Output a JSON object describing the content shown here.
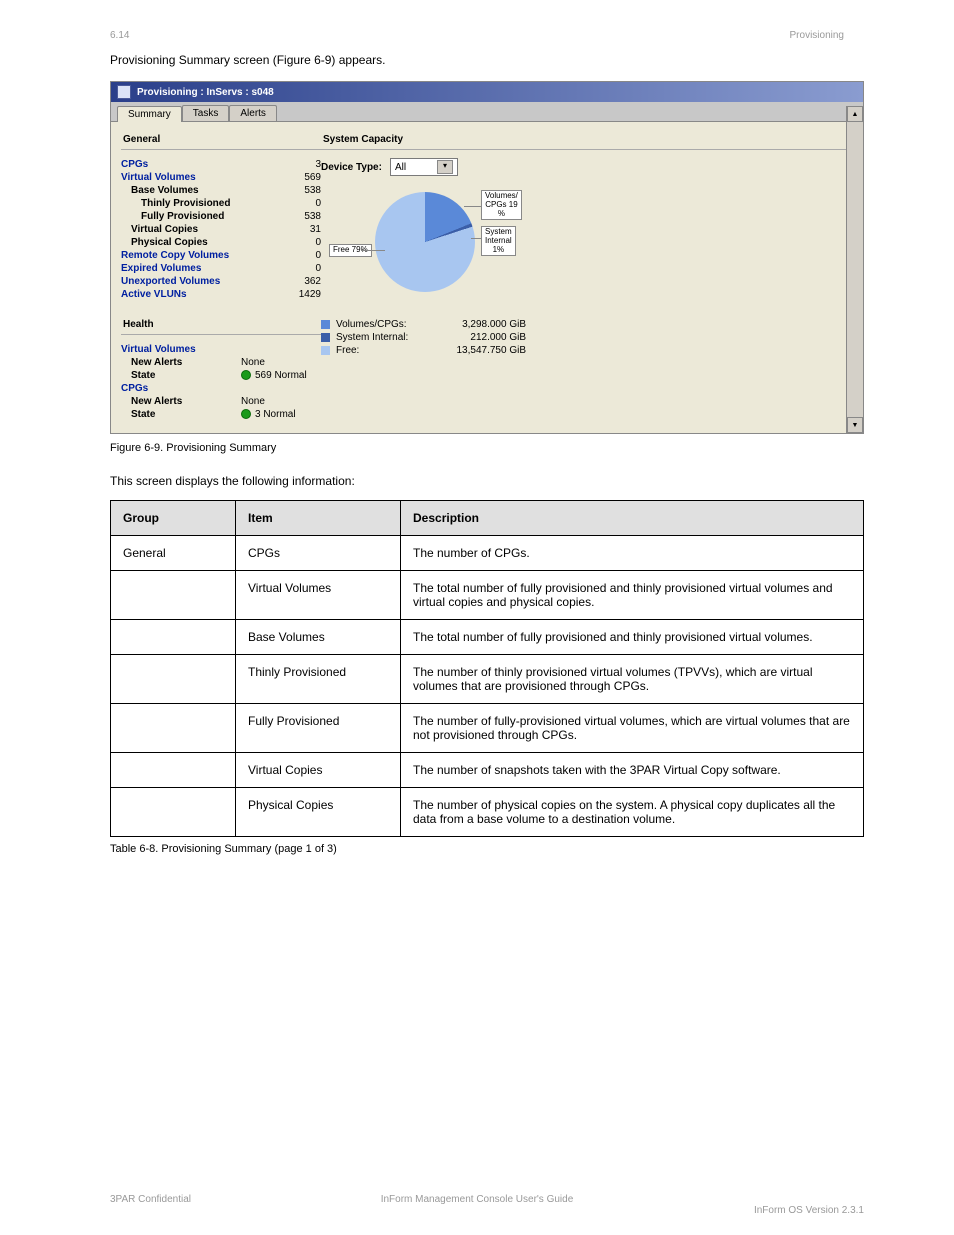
{
  "header": {
    "left": "6.14",
    "right": "Provisioning"
  },
  "intro": "Provisioning Summary screen (Figure 6-9) appears.",
  "window": {
    "title": "Provisioning : InServs : s048",
    "tabs": [
      "Summary",
      "Tasks",
      "Alerts"
    ],
    "sections": {
      "general_title": "General",
      "capacity_title": "System Capacity",
      "health_title": "Health"
    },
    "general": [
      {
        "label": "CPGs",
        "value": "3",
        "link": true,
        "indent": 0
      },
      {
        "label": "Virtual Volumes",
        "value": "569",
        "link": true,
        "indent": 0
      },
      {
        "label": "Base Volumes",
        "value": "538",
        "link": false,
        "indent": 1
      },
      {
        "label": "Thinly Provisioned",
        "value": "0",
        "link": false,
        "indent": 2
      },
      {
        "label": "Fully Provisioned",
        "value": "538",
        "link": false,
        "indent": 2
      },
      {
        "label": "Virtual Copies",
        "value": "31",
        "link": false,
        "indent": 1
      },
      {
        "label": "Physical Copies",
        "value": "0",
        "link": false,
        "indent": 1
      },
      {
        "label": "Remote Copy Volumes",
        "value": "0",
        "link": true,
        "indent": 0
      },
      {
        "label": "Expired Volumes",
        "value": "0",
        "link": true,
        "indent": 0
      },
      {
        "label": "Unexported Volumes",
        "value": "362",
        "link": true,
        "indent": 0
      },
      {
        "label": "Active VLUNs",
        "value": "1429",
        "link": true,
        "indent": 0
      }
    ],
    "device_type_label": "Device Type:",
    "device_type_value": "All",
    "callouts": {
      "free": "Free 79%",
      "vol": "Volumes/\nCPGs 19\n%",
      "sys": "System\nInternal\n1%"
    },
    "legend": [
      {
        "label": "Volumes/CPGs:",
        "value": "3,298.000 GiB",
        "sw": "blue1"
      },
      {
        "label": "System Internal:",
        "value": "212.000 GiB",
        "sw": "blue2"
      },
      {
        "label": "Free:",
        "value": "13,547.750 GiB",
        "sw": "blue3"
      }
    ],
    "health": {
      "vv": {
        "title": "Virtual Volumes",
        "alerts_label": "New Alerts",
        "alerts_value": "None",
        "state_label": "State",
        "state_value": "569 Normal"
      },
      "cpg": {
        "title": "CPGs",
        "alerts_label": "New Alerts",
        "alerts_value": "None",
        "state_label": "State",
        "state_value": "3 Normal"
      }
    }
  },
  "fig_caption": "Figure 6-9.  Provisioning Summary",
  "explain": "This screen displays the following information:",
  "chart_data": {
    "type": "pie",
    "title": "System Capacity",
    "series": [
      {
        "name": "Volumes/CPGs",
        "value": 3298.0,
        "percent": 19,
        "unit": "GiB"
      },
      {
        "name": "System Internal",
        "value": 212.0,
        "percent": 1,
        "unit": "GiB"
      },
      {
        "name": "Free",
        "value": 13547.75,
        "percent": 79,
        "unit": "GiB"
      }
    ]
  },
  "table": {
    "headers": [
      "Group",
      "Item",
      "Description"
    ],
    "rows": [
      {
        "group": "General",
        "item": "CPGs",
        "desc": "The number of CPGs."
      },
      {
        "group": "",
        "item": "Virtual Volumes",
        "desc": "The total number of fully provisioned and thinly provisioned virtual volumes and virtual copies and physical copies."
      },
      {
        "group": "",
        "item": "Base Volumes",
        "desc": "The total number of fully provisioned and thinly provisioned virtual volumes."
      },
      {
        "group": "",
        "item": "Thinly Provisioned",
        "desc": "The number of thinly provisioned virtual volumes (TPVVs), which are virtual volumes that are provisioned through CPGs."
      },
      {
        "group": "",
        "item": "Fully Provisioned",
        "desc": "The number of fully-provisioned virtual volumes, which are virtual volumes that are not provisioned through CPGs."
      },
      {
        "group": "",
        "item": "Virtual Copies",
        "desc": "The number of snapshots taken with the 3PAR Virtual Copy software."
      },
      {
        "group": "",
        "item": "Physical Copies",
        "desc": "The number of physical copies on the system. A physical copy duplicates all the data from a base volume to a destination volume."
      }
    ]
  },
  "table_caption": "Table 6-8.  Provisioning Summary (page 1 of 3)",
  "footer": {
    "left": "3PAR Confidential",
    "center": "InForm Management Console User's Guide",
    "right": "InForm OS Version 2.3.1"
  }
}
